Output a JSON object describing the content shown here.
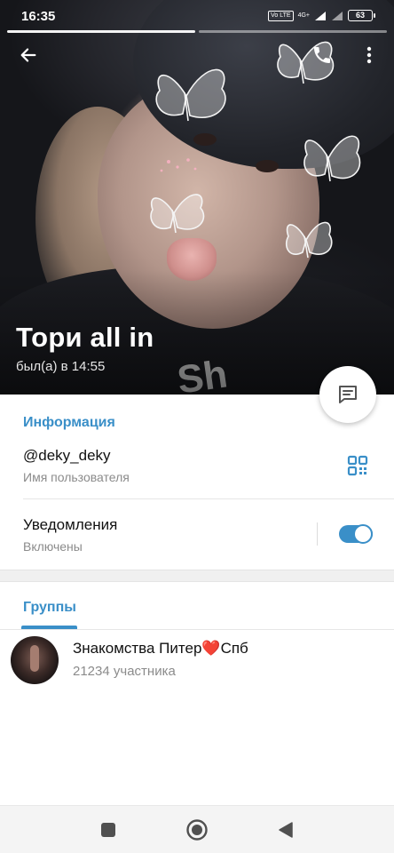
{
  "status_bar": {
    "time": "16:35",
    "network_label": "4G+",
    "signal_label": "Vo LTE",
    "battery_level": "63"
  },
  "header": {
    "name": "Тори all in",
    "last_seen": "был(а) в 14:55",
    "shirt_print": "Sh"
  },
  "info": {
    "section_title": "Информация",
    "username": "@deky_deky",
    "username_label": "Имя пользователя",
    "notifications_title": "Уведомления",
    "notifications_status": "Включены",
    "notifications_enabled": true
  },
  "groups": {
    "tab_label": "Группы",
    "items": [
      {
        "name": "Знакомства Питер❤️Спб",
        "members": "21234 участника"
      }
    ]
  },
  "colors": {
    "accent": "#3a8fc8",
    "muted_text": "#8b8b8b",
    "divider": "#e6e6e6"
  },
  "icons": {
    "back": "arrow-left-icon",
    "call": "phone-icon",
    "menu": "more-vertical-icon",
    "message": "chat-bubble-icon",
    "qr": "qr-code-icon",
    "nav_recents": "square-icon",
    "nav_home": "circle-icon",
    "nav_back": "triangle-icon"
  }
}
